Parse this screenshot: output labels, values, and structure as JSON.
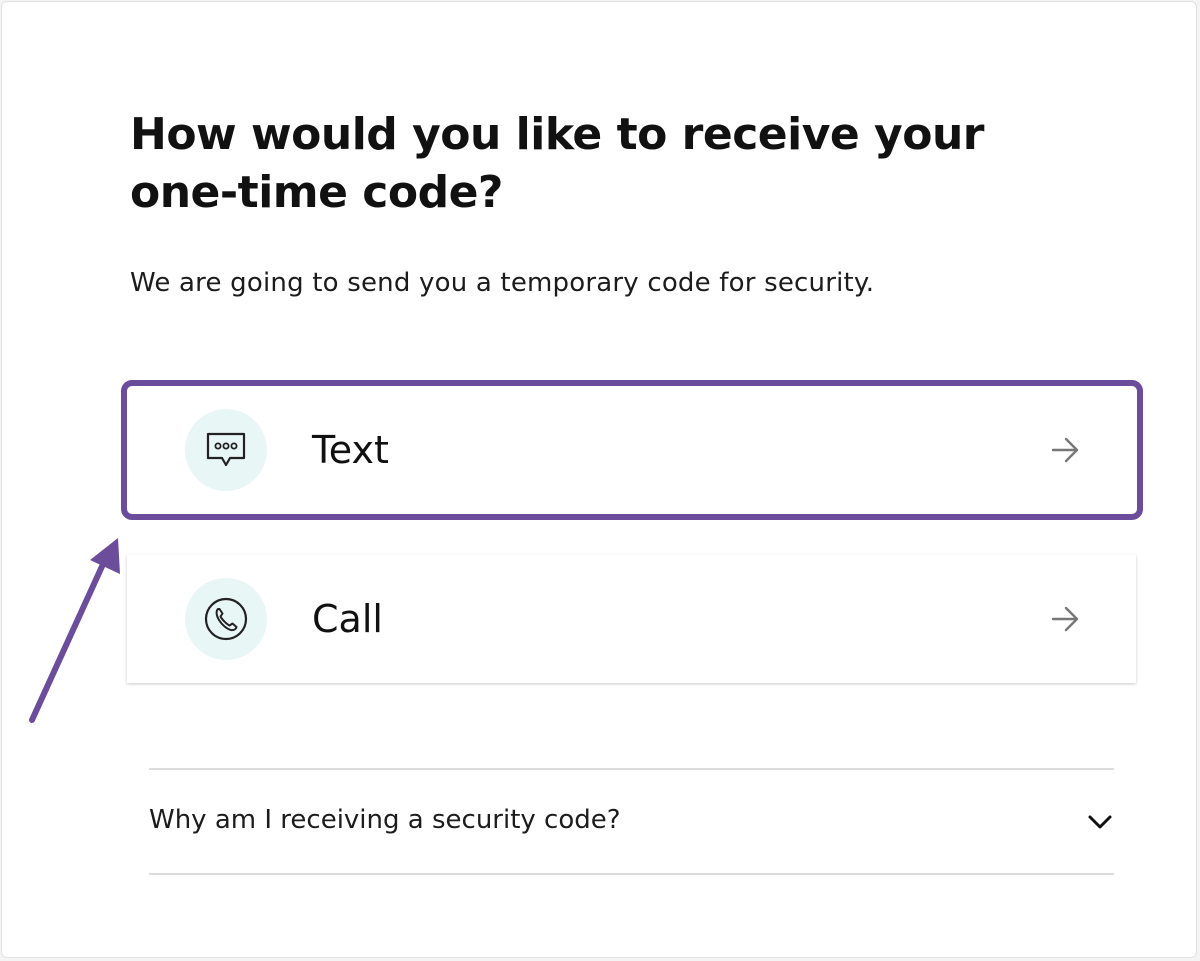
{
  "heading": "How would you like to receive your one-time code?",
  "description": "We are going to send you a temporary code for security.",
  "options": [
    {
      "label": "Text",
      "icon": "message-bubble-icon",
      "action_icon": "arrow-right-icon",
      "highlighted": true
    },
    {
      "label": "Call",
      "icon": "phone-icon",
      "action_icon": "arrow-right-icon",
      "highlighted": false
    }
  ],
  "faq": {
    "question": "Why am I receiving a security code?",
    "icon": "chevron-down-icon"
  },
  "colors": {
    "highlight": "#6b4d9b",
    "icon_bg": "#e9f6f6",
    "text": "#111111"
  }
}
